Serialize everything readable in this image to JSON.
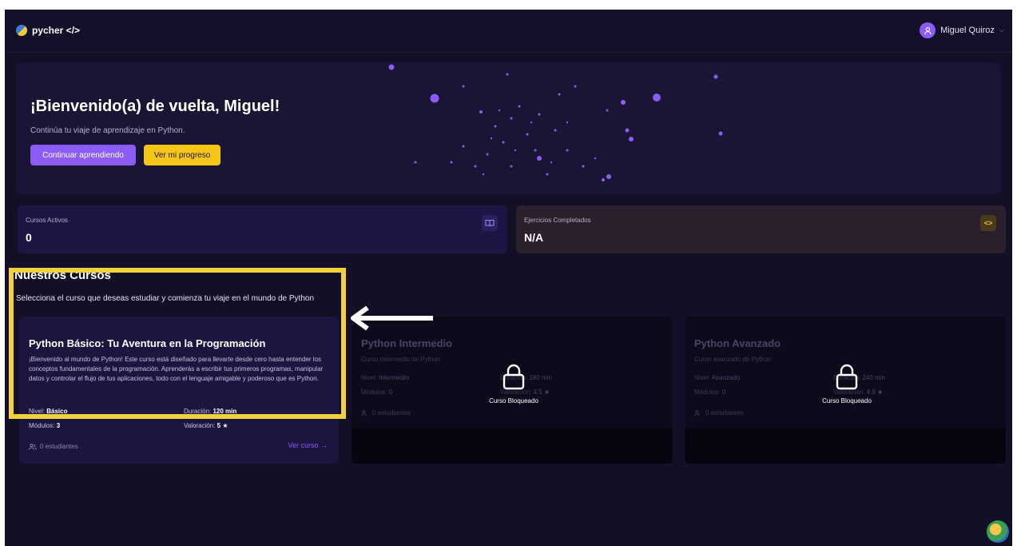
{
  "app": {
    "logo_text": "pycher </>"
  },
  "user": {
    "name": "Miguel Quiroz"
  },
  "hero": {
    "title": "¡Bienvenido(a) de vuelta, Miguel!",
    "subtitle": "Continúa tu viaje de aprendizaje en Python.",
    "primary_button": "Continuar aprendiendo",
    "secondary_button": "Ver mi progreso"
  },
  "stats": [
    {
      "label": "Cursos Activos",
      "value": "0",
      "icon": "book-open-icon"
    },
    {
      "label": "Ejercicios Completados",
      "value": "N/A",
      "icon": "code-icon"
    }
  ],
  "section": {
    "title": "Nuestros Cursos",
    "subtitle": "Selecciona el curso que deseas estudiar y comienza tu viaje en el mundo de Python"
  },
  "courses": [
    {
      "title": "Python Básico: Tu Aventura en la Programación",
      "description": "¡Bienvenido al mundo de Python! Este curso está diseñado para llevarte desde cero hasta entender los conceptos fundamentales de la programación. Aprenderás a escribir tus primeros programas, manipular datos y controlar el flujo de tus aplicaciones, todo con el lenguaje amigable y poderoso que es Python.",
      "level_label": "Nivel:",
      "level": "Básico",
      "duration_label": "Duración:",
      "duration": "120 min",
      "modules_label": "Módulos:",
      "modules": "3",
      "rating_label": "Valoración:",
      "rating": "5 ★",
      "students": "0 estudiantes",
      "link": "Ver curso →",
      "locked": false
    },
    {
      "title": "Python Intermedio",
      "description": "Curso intermedio de Python",
      "level_label": "Nivel:",
      "level": "Intermedio",
      "duration_label": "Duración:",
      "duration": "180 min",
      "modules_label": "Módulos:",
      "modules": "0",
      "rating_label": "Valoración:",
      "rating": "4.5 ★",
      "students": "0 estudiantes",
      "lock_label": "Curso Bloqueado",
      "locked": true
    },
    {
      "title": "Python Avanzado",
      "description": "Curso avanzado de Python",
      "level_label": "Nivel:",
      "level": "Avanzado",
      "duration_label": "Duración:",
      "duration": "240 min",
      "modules_label": "Módulos:",
      "modules": "0",
      "rating_label": "Valoración:",
      "rating": "4.8 ★",
      "students": "0 estudiantes",
      "lock_label": "Curso Bloqueado",
      "locked": true
    }
  ],
  "colors": {
    "accent": "#8b5cf6",
    "highlight": "#f2d23c",
    "background": "#130f26",
    "button_yellow": "#f5c518"
  }
}
